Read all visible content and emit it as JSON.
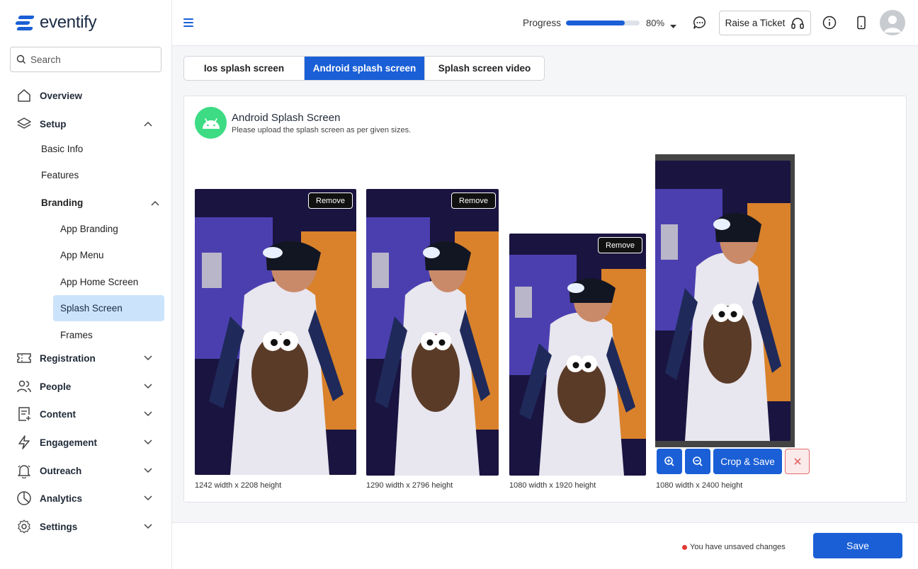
{
  "app": {
    "brand": "eventify"
  },
  "search": {
    "placeholder": "Search"
  },
  "sidebar": {
    "overview": "Overview",
    "setup": "Setup",
    "basic_info": "Basic Info",
    "features": "Features",
    "branding": "Branding",
    "app_branding": "App Branding",
    "app_menu": "App Menu",
    "app_home_screen": "App Home Screen",
    "splash_screen": "Splash Screen",
    "frames": "Frames",
    "registration": "Registration",
    "people": "People",
    "content": "Content",
    "engagement": "Engagement",
    "outreach": "Outreach",
    "analytics": "Analytics",
    "settings": "Settings"
  },
  "header": {
    "progress_label": "Progress",
    "progress_value": 0.8,
    "progress_text": "80%",
    "ticket_label": "Raise a Ticket"
  },
  "tabs": [
    "Ios splash screen",
    "Android splash screen",
    "Splash screen video"
  ],
  "active_tab": 1,
  "card": {
    "title": "Android Splash Screen",
    "subtitle": "Please upload the splash screen as per given sizes."
  },
  "screens": [
    {
      "caption": "1242 width x 2208 height",
      "remove_label": "Remove"
    },
    {
      "caption": "1290 width x 2796 height",
      "remove_label": "Remove"
    },
    {
      "caption": "1080 width x 1920 height",
      "remove_label": "Remove"
    },
    {
      "caption": "1080 width x 2400 height"
    }
  ],
  "crop_tools": {
    "crop_save_label": "Crop & Save"
  },
  "footer": {
    "unsaved_text": "You have unsaved changes",
    "save_label": "Save"
  },
  "colors": {
    "accent": "#1a5fd6",
    "android": "#3ddc84",
    "active_nav": "#cce4fb",
    "danger": "#e53935"
  }
}
